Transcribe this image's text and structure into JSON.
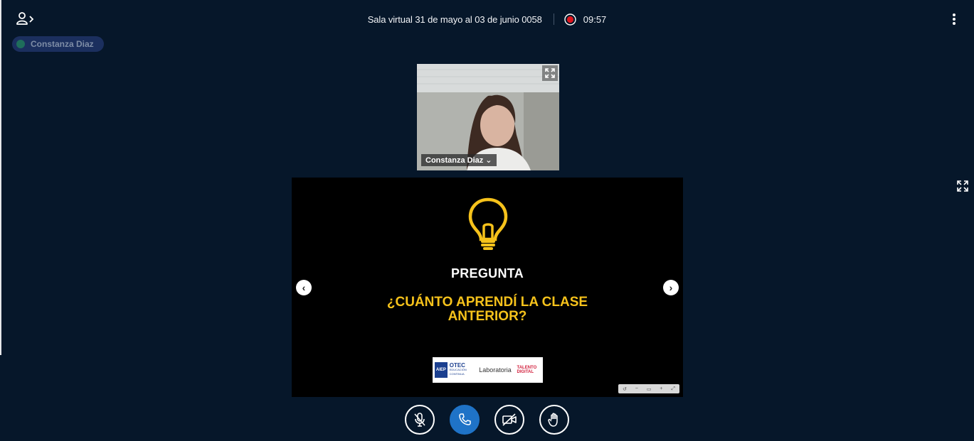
{
  "header": {
    "title": "Sala virtual 31 de mayo al 03 de junio 0058",
    "timer": "09:57",
    "icons": {
      "users": "users-toggle-icon",
      "record": "record-icon",
      "more": "more-options-icon"
    }
  },
  "talking_indicator": {
    "name": "Constanza Diaz"
  },
  "webcam": {
    "user_name": "Constanza Diaz",
    "dropdown_glyph": "⌄"
  },
  "presentation": {
    "heading": "PREGUNTA",
    "question_line1": "¿CUÁNTO APRENDÍ LA CLASE",
    "question_line2": "ANTERIOR?",
    "prev_glyph": "‹",
    "next_glyph": "›",
    "logos": {
      "aiep": "AIEP",
      "otec": "OTEC",
      "otec_sub": "EDUCACIÓN CONTINUA",
      "laboratoria": "Laboratoria",
      "talento": "TALENTO DIGITAL"
    }
  },
  "colors": {
    "background": "#06172a",
    "accent_blue": "#1f73c7",
    "question_yellow": "#f6c21b",
    "record_red": "#e0141c"
  },
  "controls": {
    "mute": "muted-microphone-icon",
    "leave_audio": "phone-icon",
    "video": "video-off-icon",
    "raise_hand": "raise-hand-icon"
  }
}
